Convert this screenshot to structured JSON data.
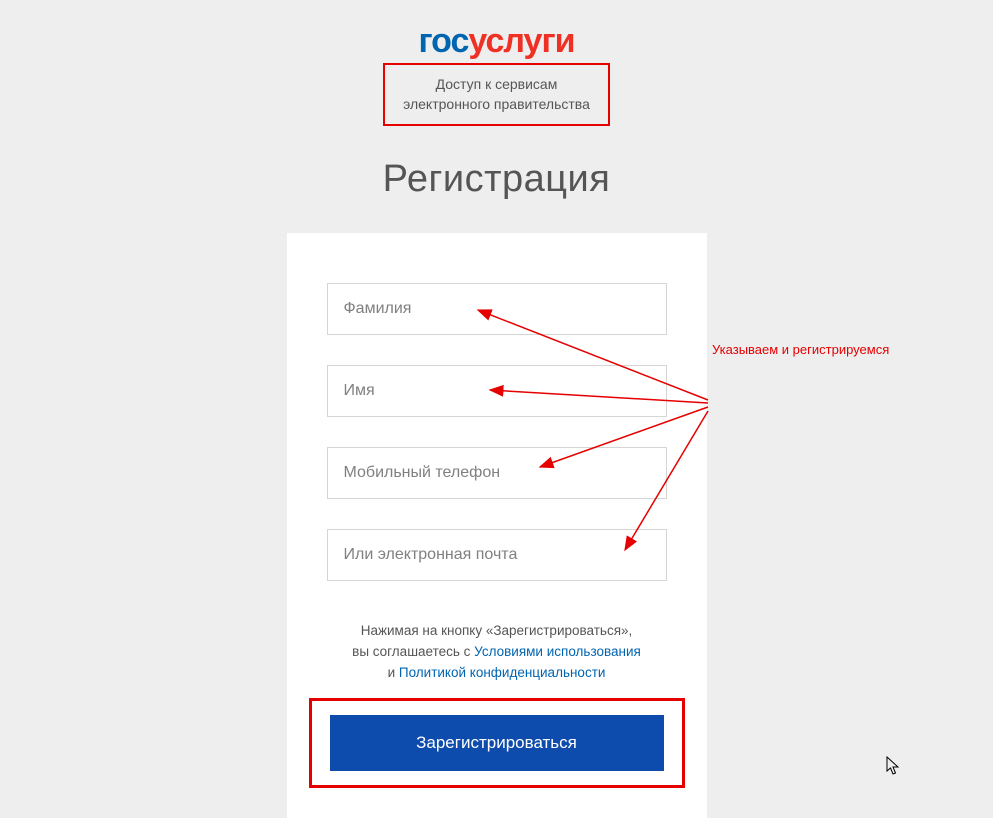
{
  "logo": {
    "part1": "гос",
    "part2": "услуги"
  },
  "tagline": {
    "line1": "Доступ к сервисам",
    "line2": "электронного правительства"
  },
  "page_title": "Регистрация",
  "form": {
    "surname_placeholder": "Фамилия",
    "name_placeholder": "Имя",
    "phone_placeholder": "Мобильный телефон",
    "email_placeholder": "Или электронная почта"
  },
  "consent": {
    "text1": "Нажимая на кнопку «Зарегистрироваться»,",
    "text2": "вы соглашаетесь с ",
    "link1": "Условиями использования",
    "text3": "и ",
    "link2": "Политикой конфиденциальности"
  },
  "register_button": "Зарегистрироваться",
  "annotation": {
    "text": "Указываем и регистрируемся",
    "color": "#e60000"
  }
}
